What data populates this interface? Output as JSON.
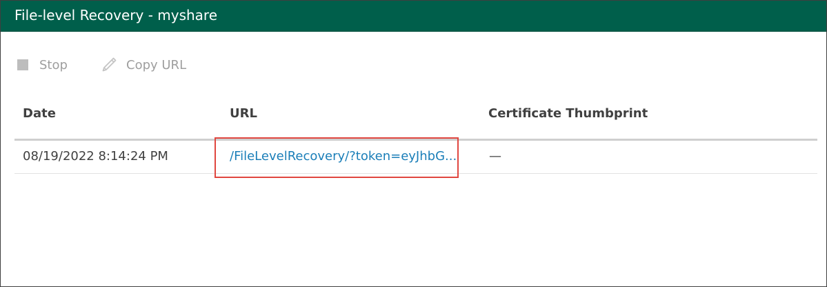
{
  "window": {
    "title": "File-level Recovery - myshare"
  },
  "toolbar": {
    "stop_label": "Stop",
    "stop_icon": "stop-square-icon",
    "copy_url_label": "Copy URL",
    "copy_url_icon": "pencil-icon",
    "disabled_color": "#9e9e9e"
  },
  "table": {
    "columns": [
      "Date",
      "URL",
      "Certificate Thumbprint"
    ],
    "rows": [
      {
        "date": "08/19/2022 8:14:24 PM",
        "url": "/FileLevelRecovery/?token=eyJhbG...",
        "certificate_thumbprint": "—"
      }
    ]
  },
  "colors": {
    "titlebar": "#005f4b",
    "link": "#1a7eb8",
    "highlight": "#e0463f"
  }
}
